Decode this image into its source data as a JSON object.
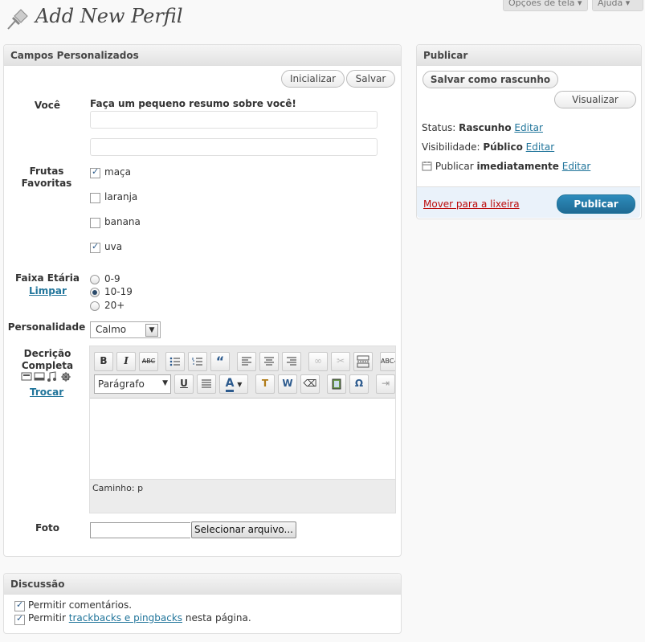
{
  "top": {
    "screen_options": "Opções de tela",
    "help": "Ajuda"
  },
  "page": {
    "title": "Add New Perfil"
  },
  "custom": {
    "header": "Campos Personalizados",
    "reset_label": "Inicializar",
    "save_label": "Salvar",
    "voce": {
      "label": "Você",
      "description": "Faça um pequeno resumo sobre você!",
      "value1": "",
      "value2": ""
    },
    "frutas": {
      "label": "Frutas Favoritas",
      "options": [
        {
          "label": "maça",
          "checked": true
        },
        {
          "label": "laranja",
          "checked": false
        },
        {
          "label": "banana",
          "checked": false
        },
        {
          "label": "uva",
          "checked": true
        }
      ]
    },
    "faixa": {
      "label": "Faixa Etária",
      "clear": "Limpar",
      "options": [
        {
          "label": "0-9",
          "selected": false
        },
        {
          "label": "10-19",
          "selected": true
        },
        {
          "label": "20+",
          "selected": false
        }
      ]
    },
    "personalidade": {
      "label": "Personalidade",
      "value": "Calmo"
    },
    "descricao": {
      "label": "Decrição Completa",
      "switch": "Trocar",
      "format": "Parágrafo",
      "path": "Caminho: p"
    },
    "foto": {
      "label": "Foto",
      "button": "Selecionar arquivo..."
    }
  },
  "publish": {
    "header": "Publicar",
    "draft": "Salvar como rascunho",
    "preview": "Visualizar",
    "status_label": "Status:",
    "status_value": "Rascunho",
    "visibility_label": "Visibilidade:",
    "visibility_value": "Público",
    "publish_label": "Publicar",
    "publish_value": "imediatamente",
    "edit": "Editar",
    "trash": "Mover para a lixeira",
    "publish_button": "Publicar"
  },
  "discussion": {
    "header": "Discussão",
    "allow_comments": "Permitir comentários.",
    "allow_prefix": "Permitir",
    "trackbacks_link": "trackbacks e pingbacks",
    "allow_suffix": "nesta página."
  },
  "colors": {
    "link": "#21759b",
    "publish_button": "#21759b",
    "trash": "#bc0b0b"
  },
  "icons": [
    "pushpin-icon",
    "bold-icon",
    "italic-icon",
    "strikethrough-icon",
    "bullet-list-icon",
    "numbered-list-icon",
    "blockquote-icon",
    "align-left-icon",
    "align-center-icon",
    "align-right-icon",
    "link-icon",
    "unlink-icon",
    "more-tag-icon",
    "spellcheck-icon",
    "underline-icon",
    "justify-icon",
    "text-color-icon",
    "paste-text-icon",
    "paste-word-icon",
    "eraser-icon",
    "media-icon",
    "omega-icon",
    "indent-icon",
    "calendar-icon",
    "image-icon",
    "video-icon",
    "audio-icon",
    "media-gear-icon"
  ]
}
